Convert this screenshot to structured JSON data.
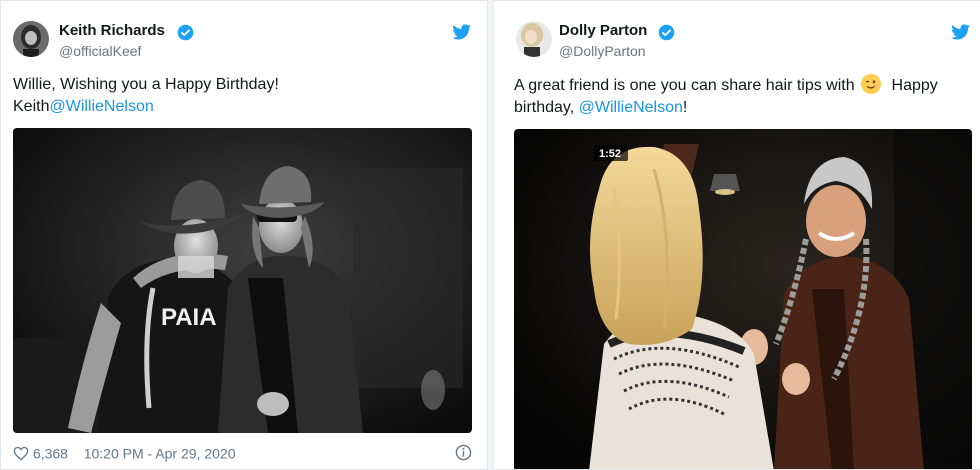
{
  "tweets": [
    {
      "author": {
        "name": "Keith Richards",
        "handle": "@officialKeef"
      },
      "text_line1": "Willie, Wishing you a Happy Birthday!",
      "text_prefix": "Keith",
      "mention": "@WillieNelson",
      "shirt_text": "PAIA",
      "likes": "6,368",
      "timestamp": "10:20 PM - Apr 29, 2020"
    },
    {
      "author": {
        "name": "Dolly Parton",
        "handle": "@DollyParton"
      },
      "text_line1_before_emoji": "A great friend is one you can share hair tips with",
      "text_line1_after_emoji": "Happy",
      "text_line2_prefix": "birthday, ",
      "mention": "@WillieNelson",
      "text_line2_suffix": "!",
      "video_timer": "1:52"
    }
  ],
  "icons": {
    "verified": "verified-badge-icon",
    "twitter": "twitter-bird-icon",
    "heart": "heart-icon",
    "info": "info-icon",
    "emoji": "winking-face-emoji"
  },
  "colors": {
    "link": "#1b95e0",
    "verified": "#1da1f2",
    "muted": "#657786"
  }
}
